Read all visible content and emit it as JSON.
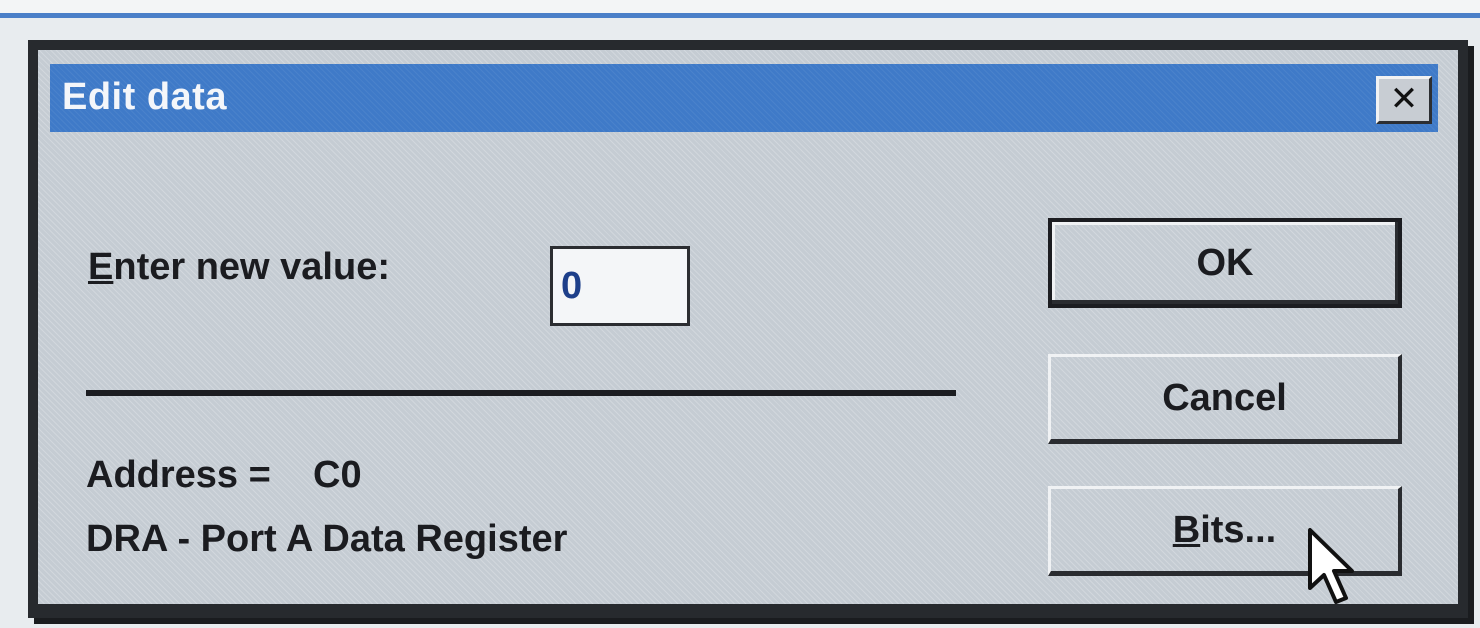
{
  "dialog": {
    "title": "Edit data",
    "close_label": "✕",
    "prompt_first_letter": "E",
    "prompt_rest": "nter new value:",
    "input_value": "0",
    "address_text": "Address =    C0",
    "register_text": "DRA - Port A Data Register"
  },
  "buttons": {
    "ok_label": "OK",
    "cancel_label": "Cancel",
    "bits_first_letter": "B",
    "bits_rest": "its..."
  },
  "icons": {
    "close": "close-icon",
    "pointer": "mouse-pointer-icon"
  },
  "colors": {
    "titlebar": "#3f7ac8",
    "dialog_face": "#c5ccd3",
    "frame": "#272a2e"
  }
}
